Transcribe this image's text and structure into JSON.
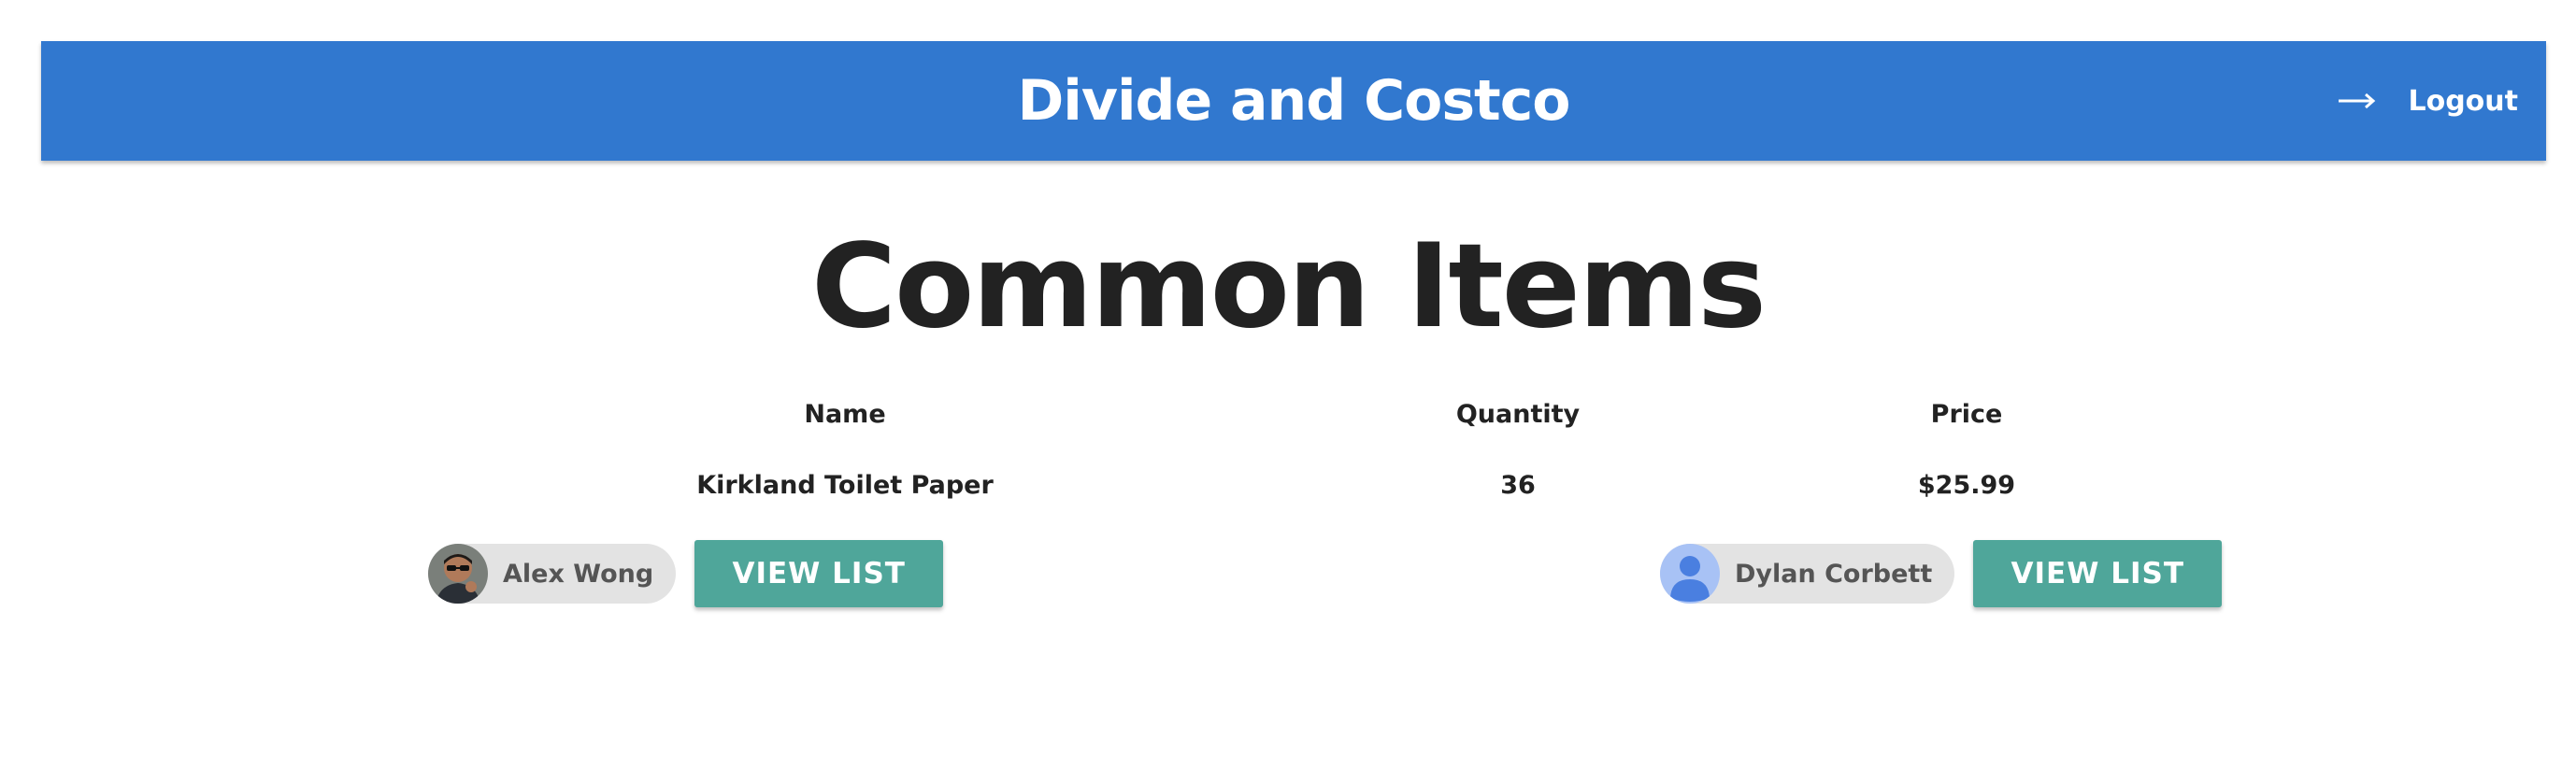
{
  "header": {
    "title": "Divide and Costco",
    "logout_label": "Logout",
    "logout_icon": "arrow-right-icon",
    "background_color": "#3178cf"
  },
  "main": {
    "heading": "Common Items",
    "table": {
      "columns": [
        "Name",
        "Quantity",
        "Price"
      ],
      "rows": [
        {
          "name": "Kirkland Toilet Paper",
          "quantity": "36",
          "price": "$25.99"
        }
      ]
    },
    "users": [
      {
        "name": "Alex Wong",
        "avatar": "photo",
        "button_label": "VIEW LIST"
      },
      {
        "name": "Dylan Corbett",
        "avatar": "default-person-icon",
        "button_label": "VIEW LIST"
      }
    ],
    "button_color": "#4fa69a"
  }
}
